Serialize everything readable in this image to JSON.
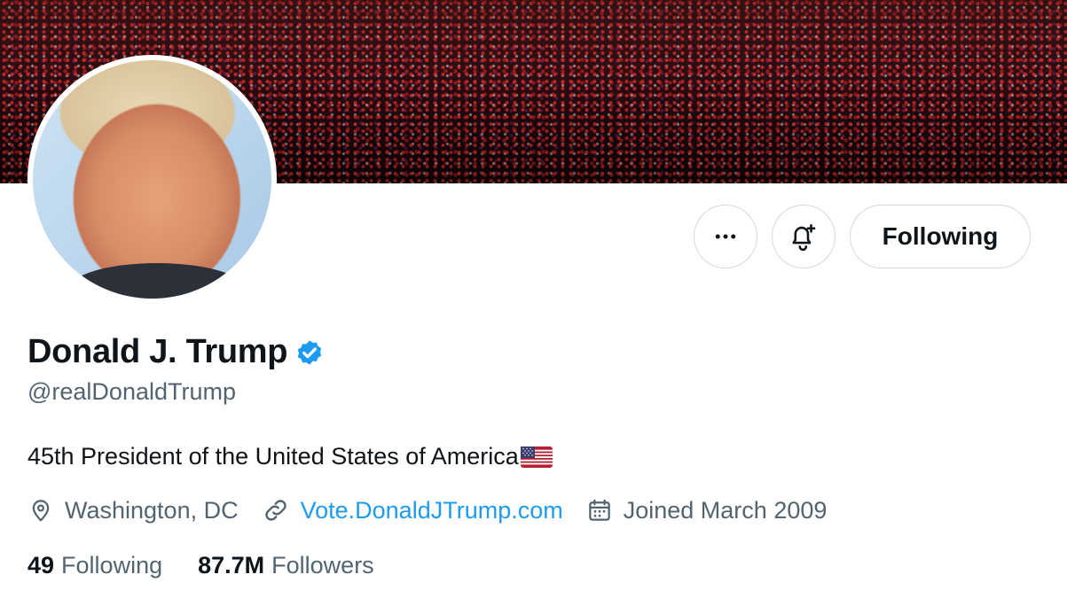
{
  "profile": {
    "name": "Donald J. Trump",
    "handle": "@realDonaldTrump",
    "bio": "45th President of the United States of America",
    "bio_emoji": "us-flag-emoji",
    "location": "Washington, DC",
    "website": "Vote.DonaldJTrump.com",
    "joined": "Joined March 2009",
    "verified": true
  },
  "stats": {
    "following_count": "49",
    "following_label": "Following",
    "followers_count": "87.7M",
    "followers_label": "Followers"
  },
  "actions": {
    "follow_state_label": "Following",
    "more_icon": "more-horizontal-icon",
    "notify_icon": "bell-plus-icon"
  },
  "colors": {
    "accent": "#1d9bf0",
    "secondary_text": "#536471",
    "primary_text": "#0f1419",
    "border": "#cfd9de"
  }
}
